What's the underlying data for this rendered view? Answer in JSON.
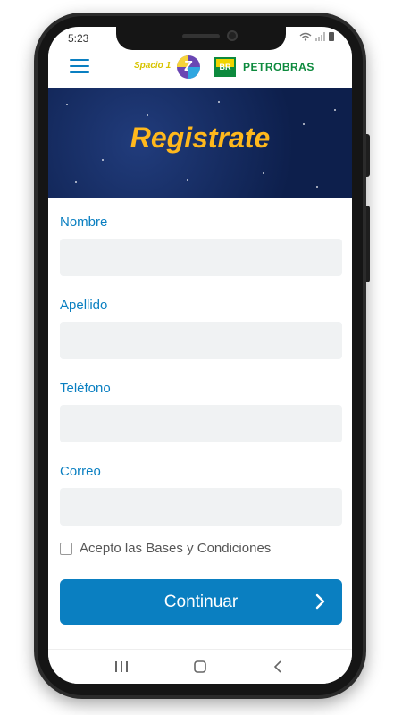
{
  "status_bar": {
    "time": "5:23",
    "icons": [
      "wifi-icon",
      "signal-icon",
      "battery-icon"
    ]
  },
  "header": {
    "menu_icon": "hamburger-menu-icon",
    "spacio_logo_text": "Spacio 1",
    "spacio_icon_text": "Z",
    "br_logo_text": "BR",
    "petrobras_text": "PETROBRAS"
  },
  "banner": {
    "title": "Registrate"
  },
  "form": {
    "fields": [
      {
        "label": "Nombre",
        "value": ""
      },
      {
        "label": "Apellido",
        "value": ""
      },
      {
        "label": "Teléfono",
        "value": ""
      },
      {
        "label": "Correo",
        "value": ""
      }
    ]
  },
  "terms": {
    "label": "Acepto las Bases y Condiciones",
    "checked": false
  },
  "continue_button": {
    "label": "Continuar"
  },
  "colors": {
    "accent": "#0a7fc1",
    "banner_bg": "#0d1f4c",
    "banner_title": "#ffb81c",
    "input_bg": "#f0f2f3",
    "petrobras_green": "#0d8a3d"
  }
}
